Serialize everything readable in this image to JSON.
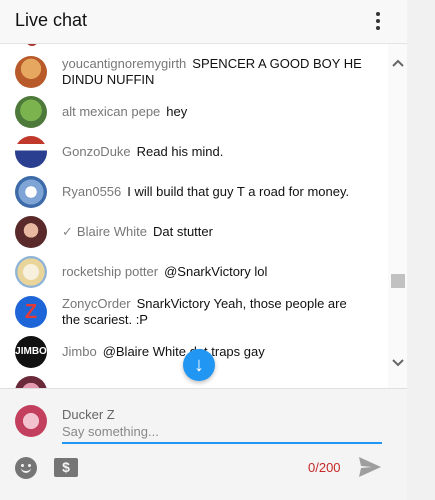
{
  "header": {
    "title": "Live chat",
    "menu_icon": "more-vert-icon"
  },
  "messages": [
    {
      "author": "youcantignoremygirth",
      "text": "SPENCER A GOOD BOY HE DINDU NUFFIN",
      "verified": false,
      "avatar_color": "#b85a2a"
    },
    {
      "author": "alt mexican pepe",
      "text": "hey",
      "verified": false,
      "avatar_color": "#4d7a3a"
    },
    {
      "author": "GonzoDuke",
      "text": "Read his mind.",
      "verified": false,
      "avatar_color": "#2a3f8f"
    },
    {
      "author": "Ryan0556",
      "text": "I will build that guy T a road for money.",
      "verified": false,
      "avatar_color": "#7fa4d6"
    },
    {
      "author": "Blaire White",
      "text": "Dat stutter",
      "verified": true,
      "avatar_color": "#5a2a2a"
    },
    {
      "author": "rocketship potter",
      "text": "@SnarkVictory lol",
      "verified": false,
      "avatar_color": "#e9d49a"
    },
    {
      "author": "ZonycOrder",
      "text": "SnarkVictory Yeah, those people are the scariest. :P",
      "verified": false,
      "avatar_color": "#1e66d8"
    },
    {
      "author": "Jimbo",
      "text": "@Blaire White dat traps gay",
      "verified": false,
      "avatar_color": "#111111"
    }
  ],
  "compose": {
    "user_name": "Ducker Z",
    "placeholder": "Say something...",
    "counter": "0/200"
  },
  "colors": {
    "accent": "#2196f3",
    "counter": "#c62828"
  }
}
